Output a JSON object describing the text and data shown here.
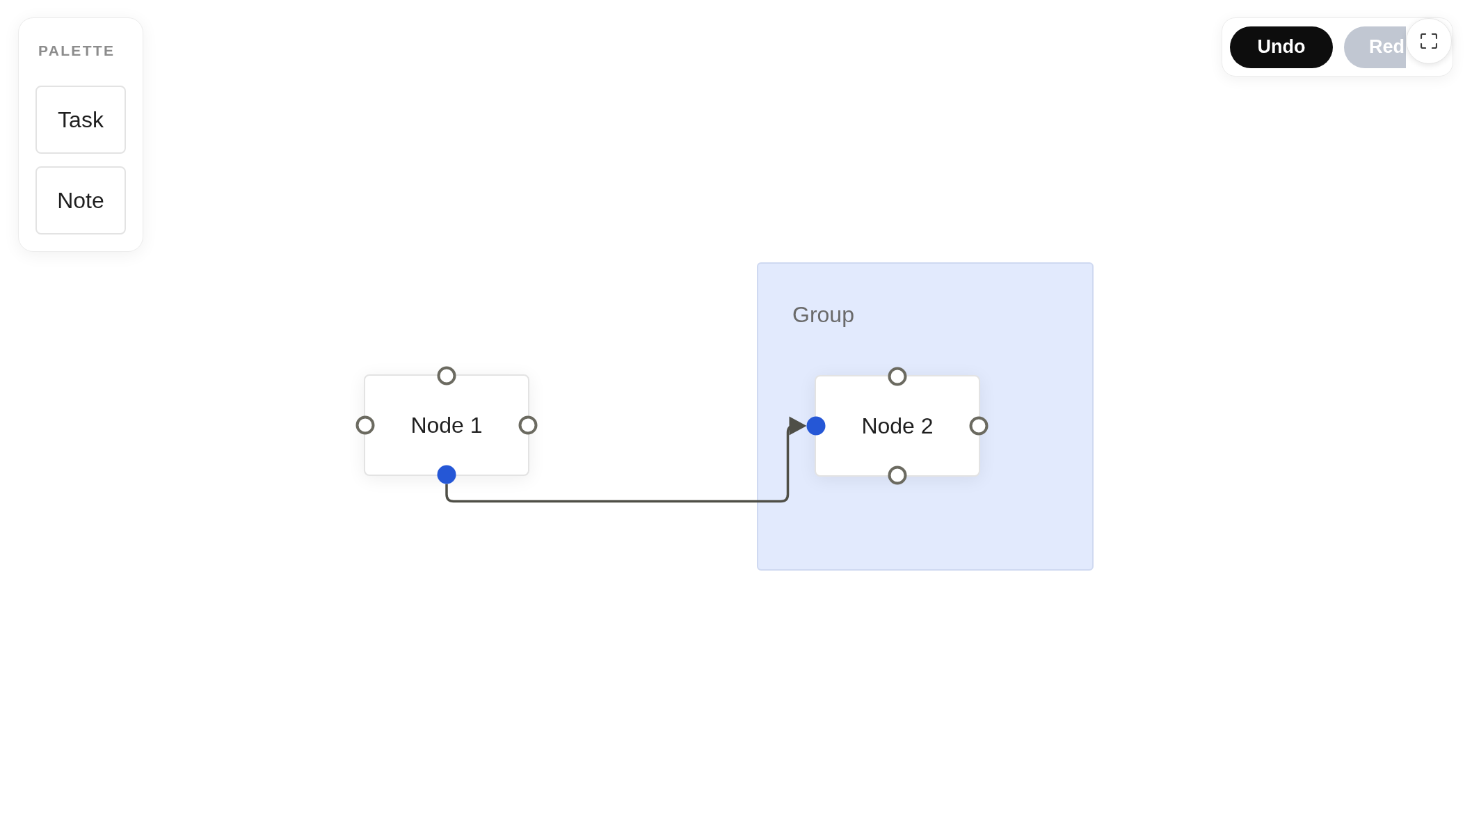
{
  "palette": {
    "title": "PALETTE",
    "items": [
      "Task",
      "Note"
    ]
  },
  "toolbar": {
    "buttons": [
      {
        "label": "Undo",
        "disabled": false
      },
      {
        "label": "Red",
        "disabled": true
      }
    ]
  },
  "canvas": {
    "nodes": [
      {
        "label": "Node 1",
        "handles": {
          "top": {
            "connected": false
          },
          "left": {
            "connected": false
          },
          "right": {
            "connected": false
          },
          "bottom": {
            "connected": true
          }
        }
      }
    ],
    "groups": [
      {
        "label": "Group",
        "nodes": [
          {
            "label": "Node 2",
            "handles": {
              "top": {
                "connected": false
              },
              "left": {
                "connected": true
              },
              "right": {
                "connected": false
              },
              "bottom": {
                "connected": false
              }
            }
          }
        ]
      }
    ],
    "edges": [
      {
        "arrow": true
      }
    ]
  }
}
